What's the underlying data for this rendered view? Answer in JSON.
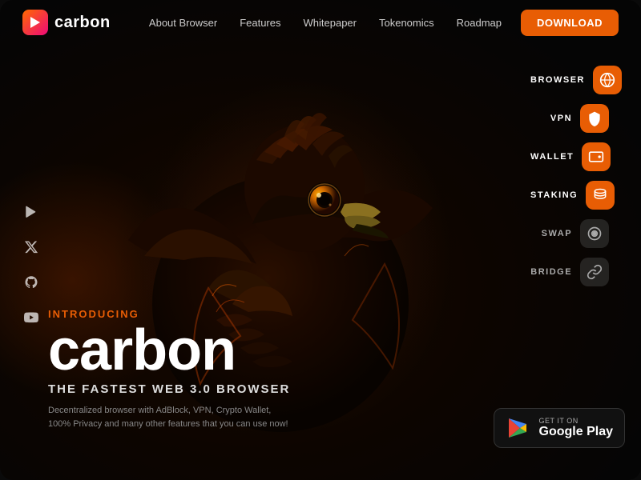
{
  "logo": {
    "icon": "▶",
    "text": "carbon"
  },
  "navbar": {
    "links": [
      {
        "label": "About Browser",
        "id": "about"
      },
      {
        "label": "Features",
        "id": "features"
      },
      {
        "label": "Whitepaper",
        "id": "whitepaper"
      },
      {
        "label": "Tokenomics",
        "id": "tokenomics"
      },
      {
        "label": "Roadmap",
        "id": "roadmap"
      }
    ],
    "download_label": "DOWNLOAD"
  },
  "social": [
    {
      "name": "google-play-icon",
      "symbol": "▶"
    },
    {
      "name": "twitter-icon",
      "symbol": "𝕏"
    },
    {
      "name": "github-icon",
      "symbol": "⬤"
    },
    {
      "name": "youtube-icon",
      "symbol": "▶"
    }
  ],
  "features": [
    {
      "label": "BROWSER",
      "active": true,
      "icon": "🌐",
      "style": "orange"
    },
    {
      "label": "VPN",
      "active": true,
      "icon": "🛡",
      "style": "orange"
    },
    {
      "label": "WALLET",
      "active": true,
      "icon": "💳",
      "style": "orange"
    },
    {
      "label": "STAKING",
      "active": true,
      "icon": "📚",
      "style": "orange"
    },
    {
      "label": "SWAP",
      "active": false,
      "icon": "🔄",
      "style": "dark"
    },
    {
      "label": "BRIDGE",
      "active": false,
      "icon": "🔗",
      "style": "dark"
    }
  ],
  "hero": {
    "introducing": "INTRODUCING",
    "title": "carbon",
    "subtitle": "THE FASTEST WEB 3.0 BROWSER",
    "description": "Decentralized browser with AdBlock, VPN, Crypto Wallet, 100% Privacy and many other features that you can use now!"
  },
  "google_play": {
    "get_it_on": "GET IT ON",
    "label": "Google Play"
  },
  "colors": {
    "accent": "#e85d04",
    "bg_dark": "#0a0a0a",
    "text_muted": "#888"
  }
}
